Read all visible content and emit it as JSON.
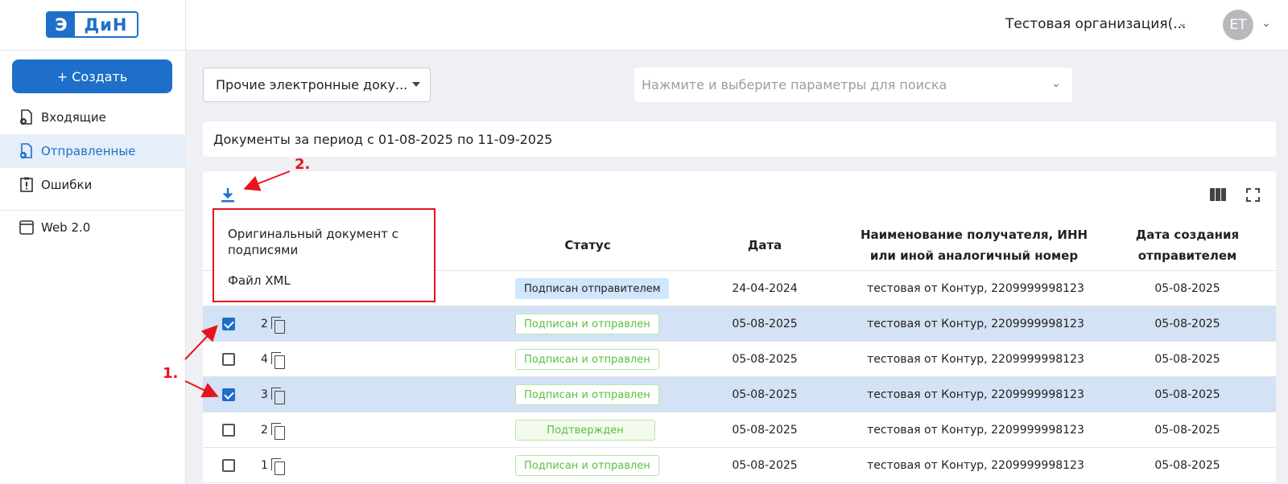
{
  "header": {
    "logo_left": "Э",
    "logo_right": "ДиН",
    "organization": "Тестовая организация(...",
    "avatar_initials": "ET"
  },
  "sidebar": {
    "create_label": "+ Создать",
    "items": [
      {
        "label": "Входящие",
        "icon": "incoming-doc-icon"
      },
      {
        "label": "Отправленные",
        "icon": "sent-doc-icon"
      },
      {
        "label": "Ошибки",
        "icon": "error-doc-icon"
      },
      {
        "label": "Web 2.0",
        "icon": "window-icon"
      }
    ]
  },
  "filters": {
    "doc_type": "Прочие электронные доку...",
    "search_placeholder": "Нажмите и выберите параметры для поиска"
  },
  "period_text": "Документы за период с 01-08-2025 по 11-09-2025",
  "popup": {
    "item1": "Оригинальный документ с подписями",
    "item2": "Файл XML"
  },
  "table": {
    "headers": {
      "status": "Статус",
      "date": "Дата",
      "recipient": "Наименование получателя, ИНН или иной аналогичный номер",
      "created": "Дата создания отправителем"
    },
    "rows": [
      {
        "num": "",
        "checked": false,
        "status": "Подписан отправителем",
        "status_style": "blue",
        "date": "24-04-2024",
        "recipient": "тестовая от Контур, 2209999998123",
        "created": "05-08-2025"
      },
      {
        "num": "2",
        "checked": true,
        "status": "Подписан и отправлен",
        "status_style": "green",
        "date": "05-08-2025",
        "recipient": "тестовая от Контур, 2209999998123",
        "created": "05-08-2025"
      },
      {
        "num": "4",
        "checked": false,
        "status": "Подписан и отправлен",
        "status_style": "green",
        "date": "05-08-2025",
        "recipient": "тестовая от Контур, 2209999998123",
        "created": "05-08-2025"
      },
      {
        "num": "3",
        "checked": true,
        "status": "Подписан и отправлен",
        "status_style": "green",
        "date": "05-08-2025",
        "recipient": "тестовая от Контур, 2209999998123",
        "created": "05-08-2025"
      },
      {
        "num": "2",
        "checked": false,
        "status": "Подтвержден",
        "status_style": "green2",
        "date": "05-08-2025",
        "recipient": "тестовая от Контур, 2209999998123",
        "created": "05-08-2025"
      },
      {
        "num": "1",
        "checked": false,
        "status": "Подписан и отправлен",
        "status_style": "green",
        "date": "05-08-2025",
        "recipient": "тестовая от Контур, 2209999998123",
        "created": "05-08-2025"
      }
    ]
  },
  "annotations": {
    "label1": "1.",
    "label2": "2."
  },
  "colors": {
    "accent": "#1e6fc9",
    "annotation": "#e8121e",
    "selected_row": "#d3e2f4"
  }
}
